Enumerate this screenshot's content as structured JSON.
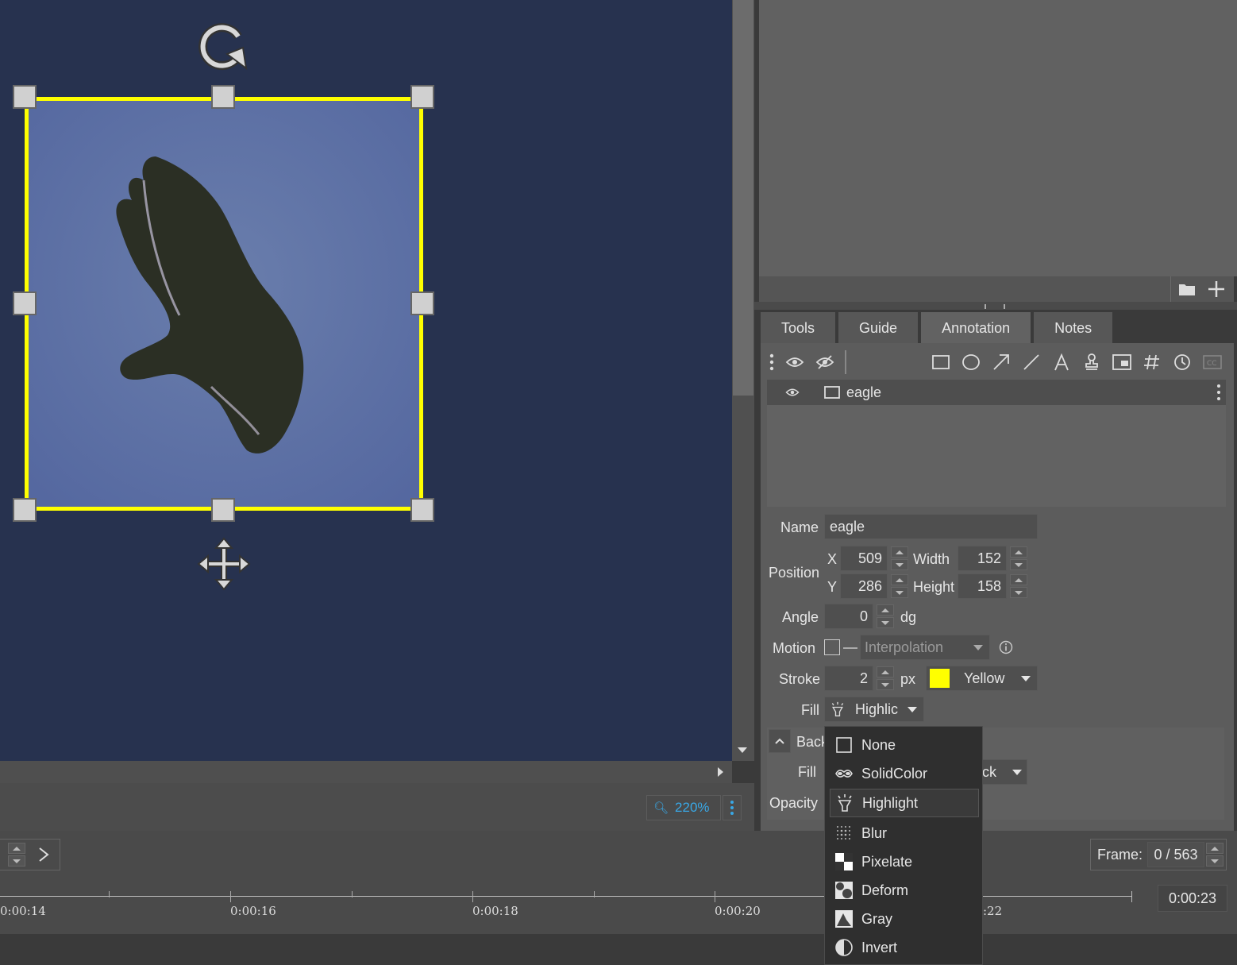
{
  "viewer": {
    "zoom": "220%",
    "roi_rotate_icon": "rotate-icon",
    "roi_move_icon": "move-icon"
  },
  "tabs": [
    {
      "label": "Tools"
    },
    {
      "label": "Guide"
    },
    {
      "label": "Annotation",
      "active": true
    },
    {
      "label": "Notes"
    }
  ],
  "layers": [
    {
      "name": "eagle",
      "visible": true
    }
  ],
  "properties": {
    "name_label": "Name",
    "name_value": "eagle",
    "position_label": "Position",
    "x_label": "X",
    "x_value": "509",
    "y_label": "Y",
    "y_value": "286",
    "width_label": "Width",
    "width_value": "152",
    "height_label": "Height",
    "height_value": "158",
    "angle_label": "Angle",
    "angle_value": "0",
    "angle_unit": "dg",
    "motion_label": "Motion",
    "motion_placeholder": "Interpolation",
    "stroke_label": "Stroke",
    "stroke_value": "2",
    "stroke_unit": "px",
    "stroke_color_name": "Yellow",
    "stroke_color": "#ffff00",
    "fill_label": "Fill",
    "fill_value": "Highlic"
  },
  "background_section": {
    "header": "Back",
    "fill_label": "Fill",
    "fill_value": "ck",
    "opacity_label": "Opacity"
  },
  "fill_menu": [
    {
      "label": "None",
      "icon": "none-icon"
    },
    {
      "label": "SolidColor",
      "icon": "solidcolor-icon"
    },
    {
      "label": "Highlight",
      "icon": "highlight-icon",
      "selected": true
    },
    {
      "label": "Blur",
      "icon": "blur-icon"
    },
    {
      "label": "Pixelate",
      "icon": "pixelate-icon"
    },
    {
      "label": "Deform",
      "icon": "deform-icon"
    },
    {
      "label": "Gray",
      "icon": "gray-icon"
    },
    {
      "label": "Invert",
      "icon": "invert-icon"
    }
  ],
  "timeline": {
    "frame_label": "Frame:",
    "frame_value": "0 / 563",
    "current_time": "0:00:23",
    "ticks": [
      "0:00:14",
      "0:00:16",
      "0:00:18",
      "0:00:20",
      ":22"
    ]
  }
}
